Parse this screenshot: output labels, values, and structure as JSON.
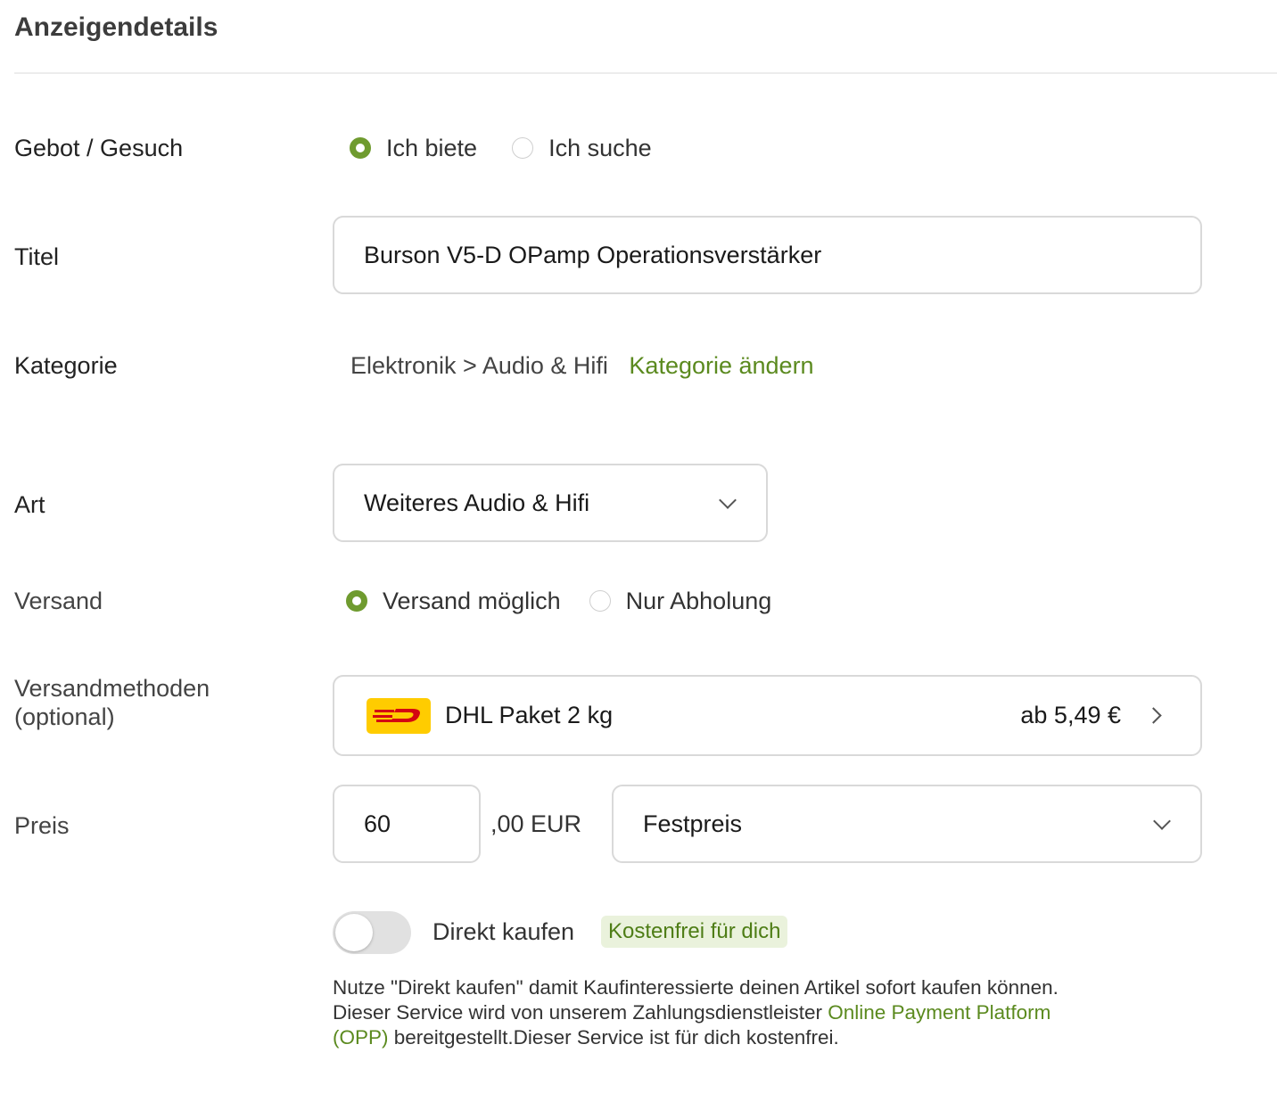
{
  "heading": "Anzeigendetails",
  "offer": {
    "label": "Gebot / Gesuch",
    "options": [
      "Ich biete",
      "Ich suche"
    ],
    "selected": "Ich biete"
  },
  "title": {
    "label": "Titel",
    "value": "Burson V5-D OPamp Operationsverstärker"
  },
  "category": {
    "label": "Kategorie",
    "path": "Elektronik > Audio & Hifi",
    "change_link": "Kategorie ändern"
  },
  "type": {
    "label": "Art",
    "selected": "Weiteres Audio & Hifi"
  },
  "shipping": {
    "label": "Versand",
    "options": [
      "Versand möglich",
      "Nur Abholung"
    ],
    "selected": "Versand möglich"
  },
  "shipping_methods": {
    "label_line1": "Versandmethoden",
    "label_line2": "(optional)",
    "method": "DHL Paket 2 kg",
    "price": "ab 5,49 €",
    "logo_colors": {
      "background": "#ffcc00",
      "mark": "#d40511"
    }
  },
  "price": {
    "label": "Preis",
    "value": "60",
    "suffix": ",00 EUR",
    "price_type": "Festpreis"
  },
  "direct_buy": {
    "label": "Direkt kaufen",
    "badge": "Kostenfrei für dich",
    "enabled": false,
    "info_part1": "Nutze \"Direkt kaufen\" damit Kaufinteressierte deinen Artikel sofort kaufen können. Dieser Service wird von unserem Zahlungsdienstleister ",
    "info_link": "Online Payment Platform (OPP)",
    "info_part2": " bereitgestellt.Dieser Service ist für dich kostenfrei."
  },
  "colors": {
    "accent": "#6f9b2f",
    "link": "#5b8a1f",
    "border": "#d9d9d9"
  }
}
